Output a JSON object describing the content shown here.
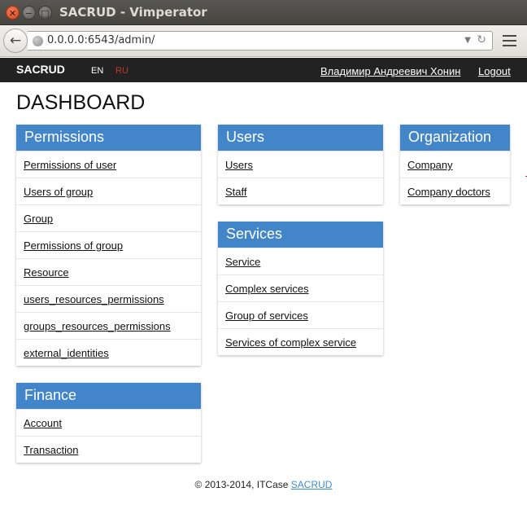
{
  "window": {
    "title": "SACRUD - Vimperator",
    "close_glyph": "✕",
    "min_glyph": "−",
    "max_glyph": "□"
  },
  "browser": {
    "back_glyph": "←",
    "url": "0.0.0.0:6543/admin/",
    "dropdown_glyph": "▼",
    "reload_glyph": "↻",
    "icons": [
      "back-arrow-icon",
      "globe-icon",
      "dropdown-icon",
      "reload-icon",
      "hamburger-menu-icon"
    ]
  },
  "navbar": {
    "brand": "SACRUD",
    "lang_en": "EN",
    "lang_ru": "RU",
    "user": "Владимир Андреевич Хонин",
    "logout": "Logout",
    "colors": {
      "background": "#222222",
      "active_lang": "#c0392b"
    }
  },
  "page": {
    "title": "DASHBOARD"
  },
  "panels": {
    "permissions": {
      "title": "Permissions",
      "items": [
        "Permissions of user",
        "Users of group",
        "Group",
        "Permissions of group",
        "Resource",
        "users_resources_permissions",
        "groups_resources_permissions",
        "external_identities"
      ]
    },
    "finance": {
      "title": "Finance",
      "items": [
        "Account",
        "Transaction"
      ]
    },
    "users": {
      "title": "Users",
      "items": [
        "Users",
        "Staff"
      ]
    },
    "services": {
      "title": "Services",
      "items": [
        "Service",
        "Complex services",
        "Group of services",
        "Services of complex service"
      ]
    },
    "organization": {
      "title": "Organization",
      "items": [
        "Company",
        "Company doctors"
      ]
    },
    "header_color": "#4285c9"
  },
  "footer": {
    "text": "© 2013-2014, ITCase",
    "link": "SACRUD"
  }
}
